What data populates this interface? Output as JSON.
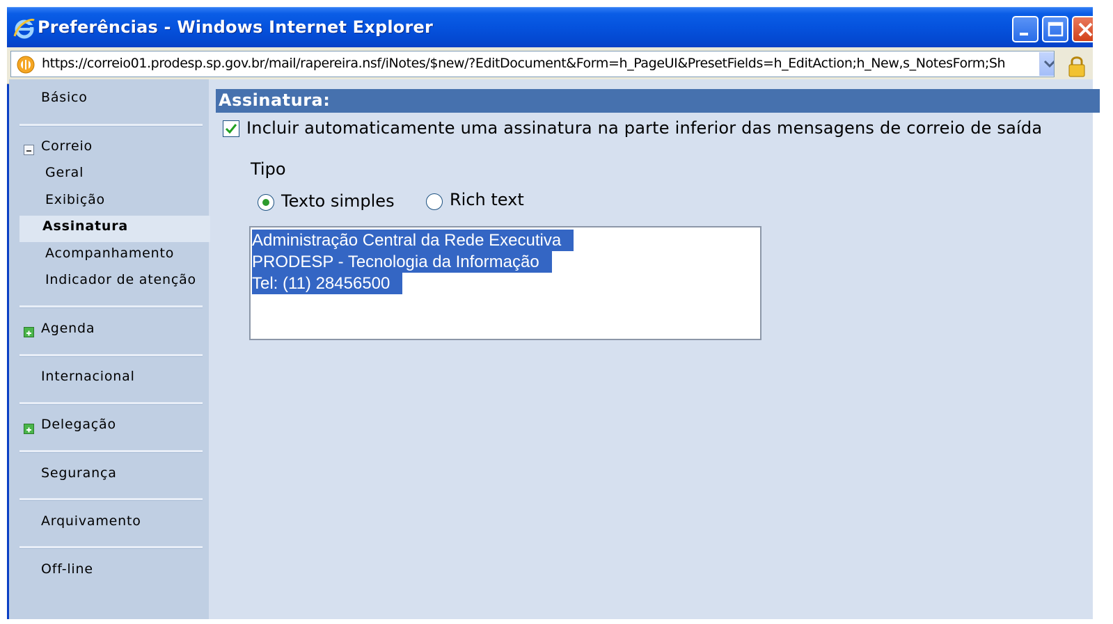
{
  "window": {
    "title": "Preferências - Windows Internet Explorer",
    "colors": {
      "titlebar": "#0552dd",
      "content_bg": "#d6e0ef",
      "sidebar_bg": "#c0cfe3",
      "header_bg": "#4671ae",
      "selection": "#3466c4"
    }
  },
  "address_bar": {
    "url": "https://correio01.prodesp.sp.gov.br/mail/rapereira.nsf/iNotes/$new/?EditDocument&Form=h_PageUI&PresetFields=h_EditAction;h_New,s_NotesForm;Sh"
  },
  "sidebar": {
    "items": [
      {
        "label": "Básico"
      },
      {
        "label": "Correio",
        "expanded": true
      },
      {
        "label": "Geral"
      },
      {
        "label": "Exibição"
      },
      {
        "label": "Assinatura",
        "selected": true
      },
      {
        "label": "Acompanhamento"
      },
      {
        "label": "Indicador de atenção"
      },
      {
        "label": "Agenda",
        "expanded": false
      },
      {
        "label": "Internacional"
      },
      {
        "label": "Delegação",
        "expanded": false
      },
      {
        "label": "Segurança"
      },
      {
        "label": "Arquivamento"
      },
      {
        "label": "Off-line"
      }
    ]
  },
  "main": {
    "section_title": "Assinatura:",
    "auto_signature": {
      "checked": true,
      "label": "Incluir automaticamente uma assinatura na parte inferior das mensagens de correio de saída"
    },
    "tipo": {
      "label": "Tipo",
      "options": [
        {
          "label": "Texto simples",
          "selected": true
        },
        {
          "label": "Rich text",
          "selected": false
        }
      ]
    },
    "signature_lines": [
      "Administração Central da Rede Executiva",
      "PRODESP - Tecnologia da Informação",
      "Tel: (11) 28456500"
    ]
  }
}
